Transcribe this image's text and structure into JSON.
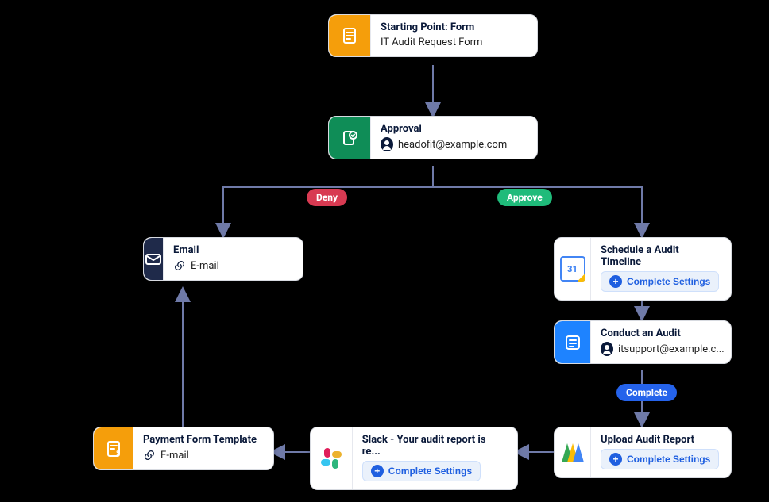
{
  "badges": {
    "deny": "Deny",
    "approve": "Approve",
    "complete": "Complete"
  },
  "buttons": {
    "complete_settings": "Complete Settings"
  },
  "nodes": {
    "start": {
      "title": "Starting Point: Form",
      "subtitle": "IT Audit Request Form",
      "icon": "document-icon",
      "icon_color": "#f59e0b"
    },
    "approval": {
      "title": "Approval",
      "assignee": "headofit@example.com",
      "icon": "approval-icon",
      "icon_color": "#0f8d57"
    },
    "email": {
      "title": "Email",
      "link_label": "E-mail",
      "icon": "email-icon",
      "icon_color": "#1f2a4a"
    },
    "schedule": {
      "title": "Schedule a Audit Timeline",
      "icon": "google-calendar-icon",
      "action": "complete_settings"
    },
    "conduct": {
      "title": "Conduct an Audit",
      "assignee": "itsupport@example.c...",
      "icon": "checklist-icon",
      "icon_color": "#1e83ff"
    },
    "upload": {
      "title": "Upload Audit Report",
      "icon": "google-drive-icon",
      "action": "complete_settings"
    },
    "slack": {
      "title": "Slack - Your audit report is re...",
      "icon": "slack-icon",
      "action": "complete_settings"
    },
    "payment": {
      "title": "Payment Form Template",
      "link_label": "E-mail",
      "icon": "payment-form-icon",
      "icon_color": "#f59e0b"
    }
  },
  "edges": [
    {
      "from": "start",
      "to": "approval"
    },
    {
      "from": "approval",
      "to": "email",
      "label": "Deny"
    },
    {
      "from": "approval",
      "to": "schedule",
      "label": "Approve"
    },
    {
      "from": "schedule",
      "to": "conduct"
    },
    {
      "from": "conduct",
      "to": "upload",
      "label": "Complete"
    },
    {
      "from": "upload",
      "to": "slack"
    },
    {
      "from": "slack",
      "to": "payment"
    },
    {
      "from": "payment",
      "to": "email"
    }
  ]
}
